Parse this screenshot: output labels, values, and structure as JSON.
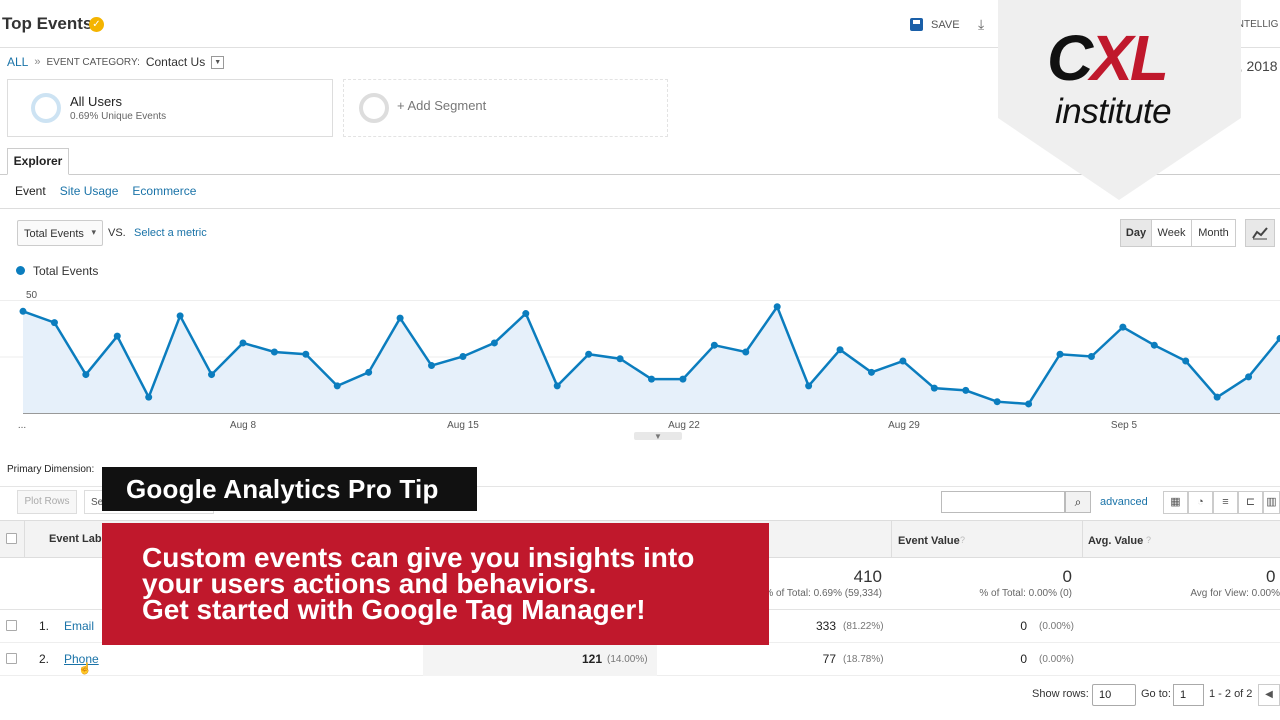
{
  "header": {
    "title": "Top Events",
    "save_label": "SAVE",
    "intelligence_label": "INTELLIG"
  },
  "breadcrumb": {
    "all": "ALL",
    "sep": "»",
    "category_key": "EVENT CATEGORY:",
    "category_value": "Contact Us"
  },
  "date_fragment": "), 2018",
  "segments": {
    "primary_name": "All Users",
    "primary_sub": "0.69% Unique Events",
    "add_label": "+ Add Segment"
  },
  "explorer": {
    "tab": "Explorer",
    "subtabs": [
      "Event",
      "Site Usage",
      "Ecommerce"
    ]
  },
  "chart_controls": {
    "metric": "Total Events",
    "vs": "VS.",
    "select_metric": "Select a metric",
    "day": "Day",
    "week": "Week",
    "month": "Month"
  },
  "chart_data": {
    "type": "area",
    "series": [
      {
        "name": "Total Events",
        "color": "#0b7dbe",
        "values": [
          45,
          40,
          17,
          34,
          7,
          43,
          17,
          31,
          27,
          26,
          12,
          18,
          42,
          21,
          25,
          31,
          44,
          12,
          26,
          24,
          15,
          15,
          30,
          27,
          47,
          12,
          28,
          18,
          23,
          11,
          10,
          5,
          4,
          26,
          25,
          38,
          30,
          23,
          7,
          16,
          33
        ]
      }
    ],
    "x_tick_labels": [
      "...",
      "Aug 8",
      "Aug 15",
      "Aug 22",
      "Aug 29",
      "Sep 5"
    ],
    "y_tick_labels": [
      "50",
      "25"
    ],
    "ylim": [
      0,
      50
    ],
    "grid": true
  },
  "primary_dimension": "Primary Dimension:",
  "table_toolbar": {
    "plot_rows": "Plot Rows",
    "secondary_fragment": "Se",
    "advanced": "advanced"
  },
  "table": {
    "headers": {
      "event_label": "Event Label",
      "event_value": "Event Value",
      "avg_value": "Avg. Value"
    },
    "totals": {
      "total_events": "410",
      "total_events_sub": "% of Total: 0.69% (59,334)",
      "event_value": "0",
      "event_value_sub": "% of Total: 0.00% (0)",
      "avg_value": "0",
      "avg_value_sub": "Avg for View: 0.00%"
    },
    "rows": [
      {
        "index": "1.",
        "label": "Email",
        "total": "333",
        "total_pct": "(81.22%)",
        "value": "0",
        "value_pct": "(0.00%)"
      },
      {
        "index": "2.",
        "label": "Phone",
        "unique": "121",
        "unique_pct": "(14.00%)",
        "total": "77",
        "total_pct": "(18.78%)",
        "value": "0",
        "value_pct": "(0.00%)"
      }
    ]
  },
  "footer": {
    "show_rows": "Show rows:",
    "rows_value": "10",
    "go_to": "Go to:",
    "goto_value": "1",
    "pager": "1 - 2 of 2"
  },
  "overlay": {
    "tip_title": "Google Analytics Pro Tip",
    "message_line1": "Custom events can give you insights into",
    "message_line2": "your users actions and behaviors.",
    "message_line3": "Get started with Google Tag Manager!"
  },
  "badge": {
    "brand_c": "C",
    "brand_xl": "XL",
    "brand_sub": "institute"
  }
}
